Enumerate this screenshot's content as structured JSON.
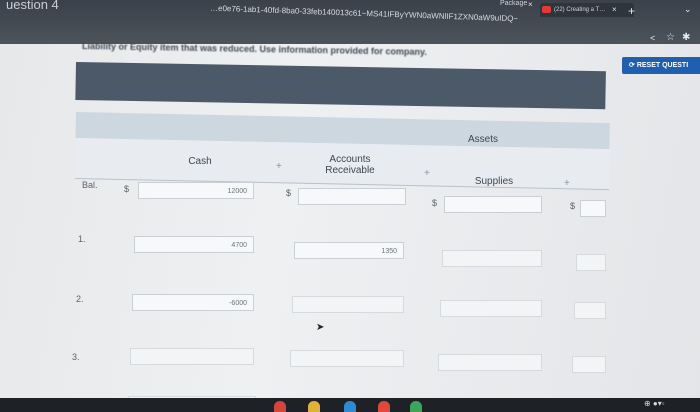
{
  "browser": {
    "question_title": "uestion 4",
    "url": "…e0e76-1ab1-40fd-8ba0-33feb140013c61~MS41IFByYWN0aWNlIF1ZXN0aW9uIDQ~",
    "tab1_label": "Package",
    "tab2_label": "(22) Creating a T…",
    "new_tab": "+",
    "close_glyph": "×",
    "chevron": "⌄",
    "share_icon": "<",
    "star_icon": "☆",
    "pin_icon": "✱"
  },
  "page": {
    "blurred_instruction": "Liability or Equity item that was reduced. Use information provided for company.",
    "reset_button": "RESET QUESTI"
  },
  "table": {
    "group_header": "Assets",
    "columns": [
      "Cash",
      "Accounts\nReceivable",
      "Supplies"
    ],
    "plus": "+",
    "dollar": "$",
    "rows": [
      {
        "label": "Bal.",
        "cash": "12000",
        "ar": "",
        "supplies": ""
      },
      {
        "label": "1.",
        "cash": "4700",
        "ar": "1350",
        "supplies": ""
      },
      {
        "label": "2.",
        "cash": "-6000",
        "ar": "",
        "supplies": ""
      },
      {
        "label": "3.",
        "cash": "",
        "ar": "",
        "supplies": ""
      }
    ]
  },
  "taskbar": {
    "tray": "⊕ ●▾◦"
  },
  "colors": {
    "chrome": "#3a414a",
    "header_band": "#4b5968",
    "assets_band": "#cdd7e0",
    "reset_button": "#1f5fb0"
  }
}
